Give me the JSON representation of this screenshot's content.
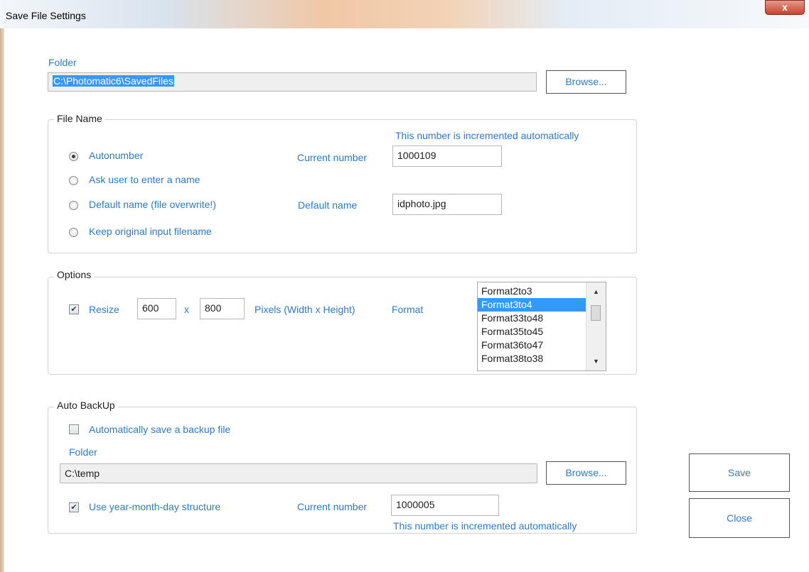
{
  "window": {
    "title": "Save File Settings",
    "close_glyph": "x"
  },
  "folder": {
    "label": "Folder",
    "path": "C:\\Photomatic6\\SavedFiles",
    "browse_label": "Browse..."
  },
  "file_name": {
    "legend": "File Name",
    "hint": "This number is incremented automatically",
    "options": [
      {
        "label": "Autonumber",
        "selected": true
      },
      {
        "label": "Ask user to enter a name",
        "selected": false
      },
      {
        "label": "Default name (file overwrite!)",
        "selected": false
      },
      {
        "label": "Keep original input filename",
        "selected": false
      }
    ],
    "current_number_label": "Current number",
    "current_number": "1000109",
    "default_name_label": "Default name",
    "default_name": "idphoto.jpg"
  },
  "options": {
    "legend": "Options",
    "resize_label": "Resize",
    "resize_checked": true,
    "width": "600",
    "x_label": "x",
    "height": "800",
    "pixels_label": "Pixels (Width x Height)",
    "format_label": "Format",
    "formats": [
      "Format2to3",
      "Format3to4",
      "Format33to48",
      "Format35to45",
      "Format36to47",
      "Format38to38"
    ],
    "selected_format": "Format3to4"
  },
  "auto_backup": {
    "legend": "Auto BackUp",
    "auto_save_label": "Automatically save a backup file",
    "auto_save_checked": false,
    "folder_label": "Folder",
    "folder_path": "C:\\temp",
    "browse_label": "Browse...",
    "ymd_label": "Use year-month-day structure",
    "ymd_checked": true,
    "current_number_label": "Current number",
    "current_number": "1000005",
    "hint": "This number is incremented automatically"
  },
  "actions": {
    "save_label": "Save",
    "close_label": "Close"
  },
  "colors": {
    "accent_text": "#2a7bd0",
    "selection": "#3399ff",
    "close_button": "#c7432e"
  }
}
